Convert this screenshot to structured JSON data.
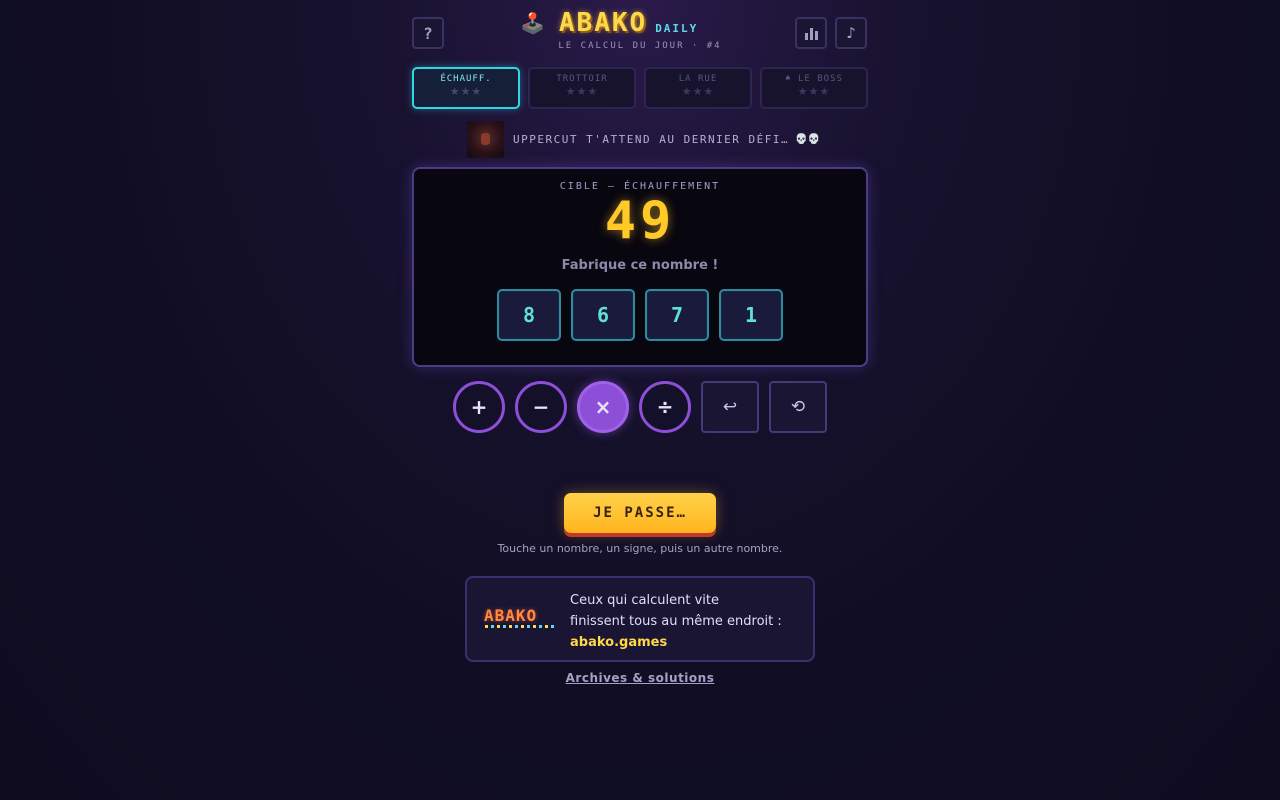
{
  "header": {
    "help_label": "?",
    "logo_icon": "joystick-icon",
    "logo_emoji": "🕹️",
    "title": "ABAKO",
    "badge": "DAILY",
    "subtitle": "LE CALCUL DU JOUR · #4",
    "stats_icon": "bar-chart-icon",
    "music_icon": "music-note-icon",
    "music_glyph": "♪"
  },
  "levels": [
    {
      "label": "ÉCHAUFF.",
      "stars": "★★★",
      "active": true
    },
    {
      "label": "TROTTOIR",
      "stars": "★★★",
      "active": false
    },
    {
      "label": "LA RUE",
      "stars": "★★★",
      "active": false
    },
    {
      "label": "♠ LE BOSS",
      "stars": "★★★",
      "active": false
    }
  ],
  "boss_message": {
    "text": "UPPERCUT T'ATTEND AU DERNIER DÉFI…",
    "emoji": "💀💀"
  },
  "panel": {
    "title": "CIBLE — ÉCHAUFFEMENT",
    "target": "49",
    "instruction": "Fabrique ce nombre !",
    "numbers": [
      "8",
      "6",
      "7",
      "1"
    ]
  },
  "operators": {
    "plus": "+",
    "minus": "−",
    "times": "×",
    "divide": "÷",
    "selected": "times",
    "undo": "↩",
    "reset": "⟲"
  },
  "actions": {
    "pass_label": "JE PASSE…",
    "hint": "Touche un nombre, un signe, puis un autre nombre."
  },
  "promo": {
    "logo": "ABAKO",
    "line1": "Ceux qui calculent vite",
    "line2": "finissent tous au même endroit :",
    "link": "abako.games"
  },
  "footer": {
    "archives": "Archives & solutions"
  },
  "colors": {
    "accent_cyan": "#33d4e6",
    "accent_purple": "#8e4fd8",
    "accent_yellow": "#ffc928",
    "background": "#110e24"
  }
}
